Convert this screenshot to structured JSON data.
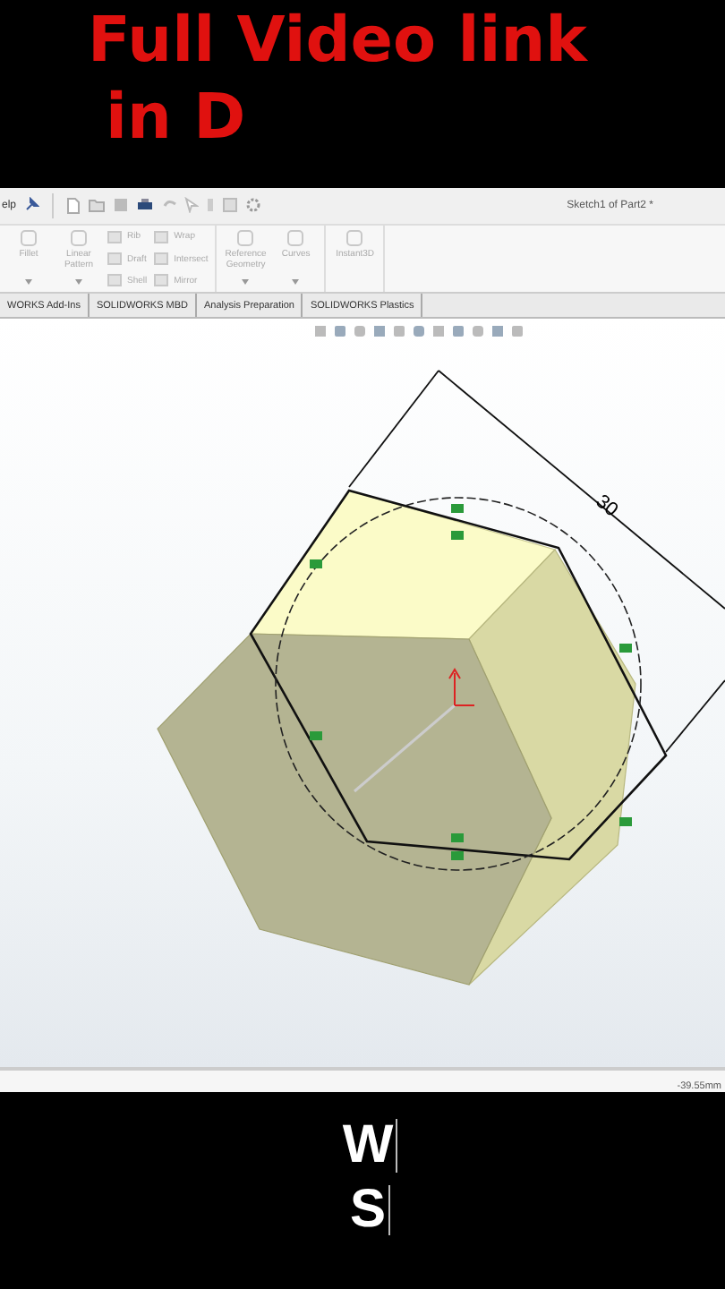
{
  "video_title": [
    "Full Video link",
    "in D"
  ],
  "menu_bar": {
    "menu": "elp",
    "document_title": "Sketch1 of Part2 *"
  },
  "ribbon_groups": [
    [
      {
        "kind": "large",
        "label": "Fillet",
        "dropdown": true
      },
      {
        "kind": "large",
        "label": "Linear Pattern",
        "dropdown": true
      },
      {
        "kind": "stack",
        "items": [
          "Rib",
          "Draft",
          "Shell"
        ]
      },
      {
        "kind": "stack",
        "items": [
          "Wrap",
          "Intersect",
          "Mirror"
        ]
      }
    ],
    [
      {
        "kind": "large",
        "label": "Reference Geometry",
        "dropdown": true
      },
      {
        "kind": "large",
        "label": "Curves",
        "dropdown": true
      }
    ],
    [
      {
        "kind": "large",
        "label": "Instant3D",
        "dropdown": false
      }
    ]
  ],
  "tabs": [
    "WORKS Add-Ins",
    "SOLIDWORKS MBD",
    "Analysis Preparation",
    "SOLIDWORKS Plastics"
  ],
  "viewport": {
    "dimension": "30"
  },
  "status_bar": {
    "coordinate": "-39.55mm"
  },
  "overlay_letters": [
    "W",
    "S"
  ]
}
